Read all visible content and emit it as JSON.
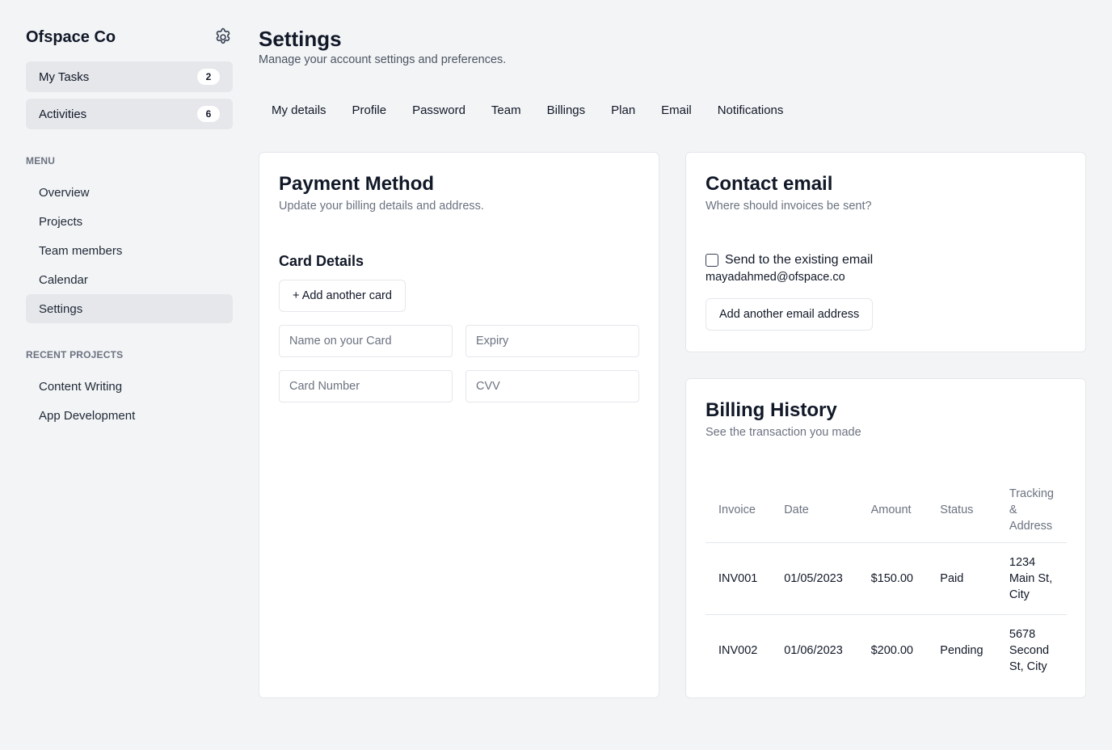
{
  "sidebar": {
    "brand": "Ofspace Co",
    "quick": [
      {
        "label": "My Tasks",
        "count": "2"
      },
      {
        "label": "Activities",
        "count": "6"
      }
    ],
    "menu_label": "MENU",
    "menu": [
      "Overview",
      "Projects",
      "Team members",
      "Calendar",
      "Settings"
    ],
    "active_menu": "Settings",
    "recent_label": "RECENT PROJECTS",
    "recent": [
      "Content Writing",
      "App Development"
    ]
  },
  "header": {
    "title": "Settings",
    "subtitle": "Manage your account settings and preferences."
  },
  "tabs": [
    "My details",
    "Profile",
    "Password",
    "Team",
    "Billings",
    "Plan",
    "Email",
    "Notifications"
  ],
  "payment": {
    "title": "Payment Method",
    "subtitle": "Update your billing details and address.",
    "section": "Card Details",
    "add_card": "+ Add another card",
    "fields": {
      "name_placeholder": "Name on your Card",
      "expiry_placeholder": "Expiry",
      "number_placeholder": "Card Number",
      "cvv_placeholder": "CVV"
    }
  },
  "contact": {
    "title": "Contact email",
    "subtitle": "Where should invoices be sent?",
    "checkbox_label": "Send to the existing email",
    "email": "mayadahmed@ofspace.co",
    "add_email": "Add another email address"
  },
  "billing": {
    "title": "Billing History",
    "subtitle": "See the transaction you made",
    "columns": [
      "Invoice",
      "Date",
      "Amount",
      "Status",
      "Tracking & Address"
    ],
    "rows": [
      {
        "invoice": "INV001",
        "date": "01/05/2023",
        "amount": "$150.00",
        "status": "Paid",
        "address": "1234 Main St, City"
      },
      {
        "invoice": "INV002",
        "date": "01/06/2023",
        "amount": "$200.00",
        "status": "Pending",
        "address": "5678 Second St, City"
      }
    ]
  },
  "icons": {
    "settings": "gear-icon",
    "checkbox": "checkbox-unchecked"
  }
}
